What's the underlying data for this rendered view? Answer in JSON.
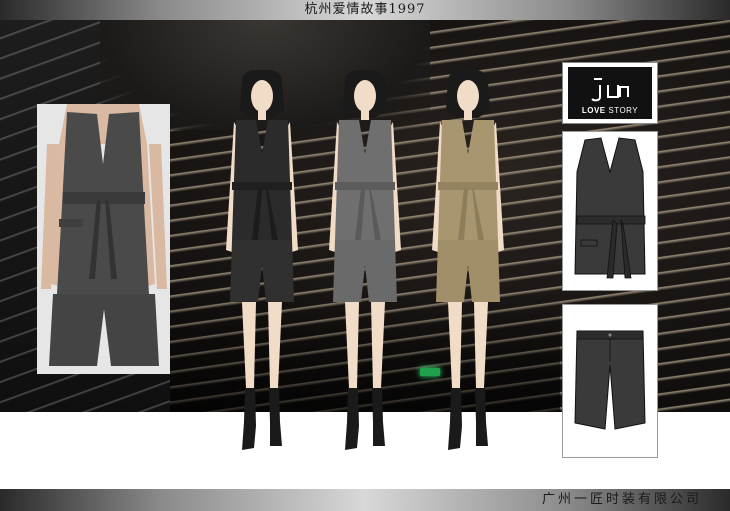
{
  "header": {
    "title": "杭州爱情故事1997"
  },
  "footer": {
    "company": "广州一匠时装有限公司"
  },
  "logo": {
    "brand": "LOVE",
    "brand_suffix": "STORY"
  },
  "figures": [
    {
      "name": "charcoal",
      "color": "#2b2b2b"
    },
    {
      "name": "grey",
      "color": "#6f6f6f"
    },
    {
      "name": "khaki",
      "color": "#a89670"
    }
  ]
}
